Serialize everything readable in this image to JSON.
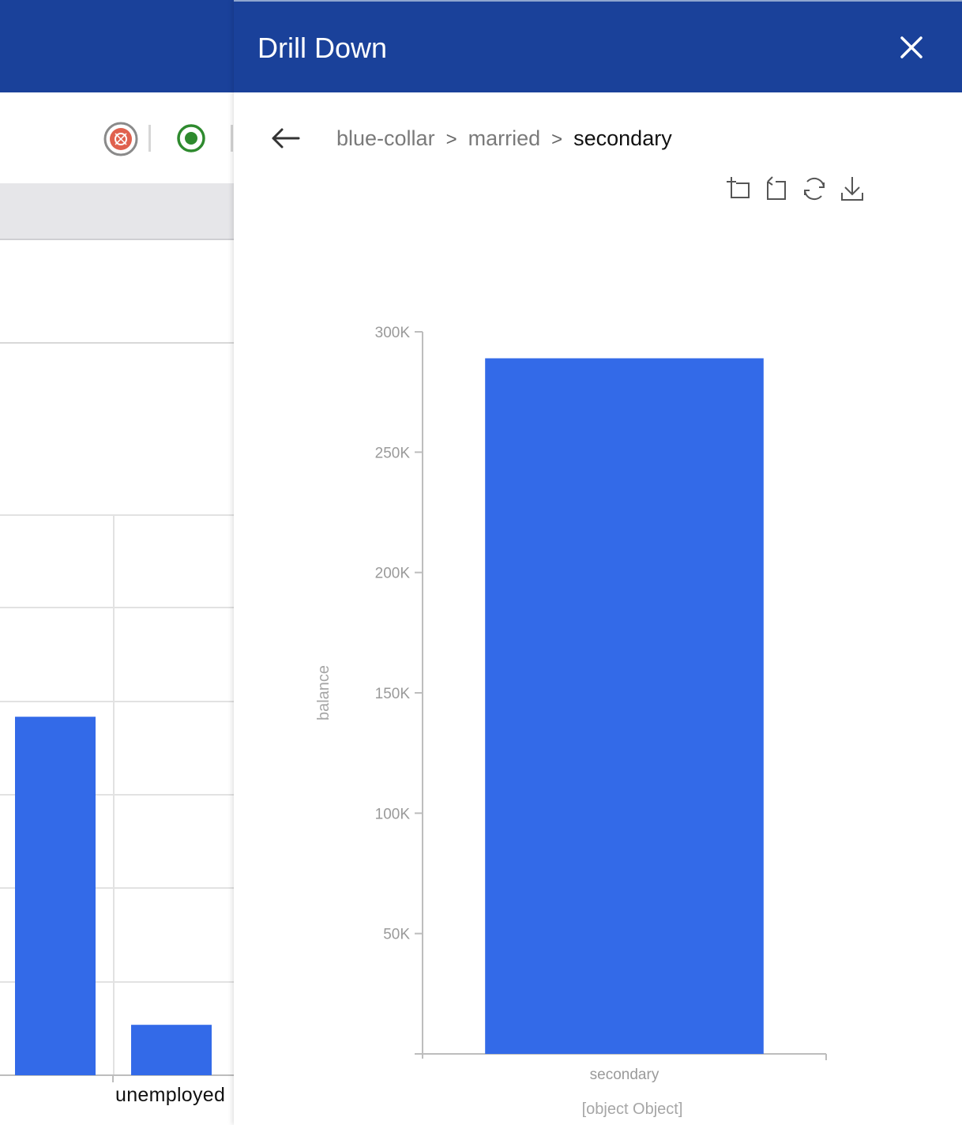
{
  "background_app": {
    "visible_category_label": "unemployed",
    "chart": {
      "type": "bar",
      "visible_bars": [
        {
          "category": "",
          "value": 0.64
        },
        {
          "category": "unemployed",
          "value": 0.09
        }
      ],
      "bar_color": "#336ae8"
    },
    "toolbar_icons": [
      "settings-badge-icon",
      "record-radio-icon"
    ],
    "header_color": "#1a419a"
  },
  "drill_down": {
    "title": "Drill Down",
    "close_icon": "close-icon",
    "back_icon": "arrow-left-icon",
    "breadcrumb": [
      "blue-collar",
      "married",
      "secondary"
    ],
    "breadcrumb_separator": ">",
    "toolbar": [
      {
        "name": "zoom-in-icon"
      },
      {
        "name": "zoom-reset-icon"
      },
      {
        "name": "refresh-icon"
      },
      {
        "name": "download-icon"
      }
    ],
    "accent_color": "#1a419a"
  },
  "chart_data": {
    "type": "bar",
    "categories": [
      "secondary"
    ],
    "series": [
      {
        "values": [
          289000
        ]
      }
    ],
    "xlabel": "[object Object]",
    "ylabel": "balance",
    "ylim": [
      0,
      300000
    ],
    "yticks": [
      50000,
      100000,
      150000,
      200000,
      250000,
      300000
    ],
    "ytick_labels": [
      "50K",
      "100K",
      "150K",
      "200K",
      "250K",
      "300K"
    ],
    "grid": false,
    "bar_color": "#336ae8"
  }
}
